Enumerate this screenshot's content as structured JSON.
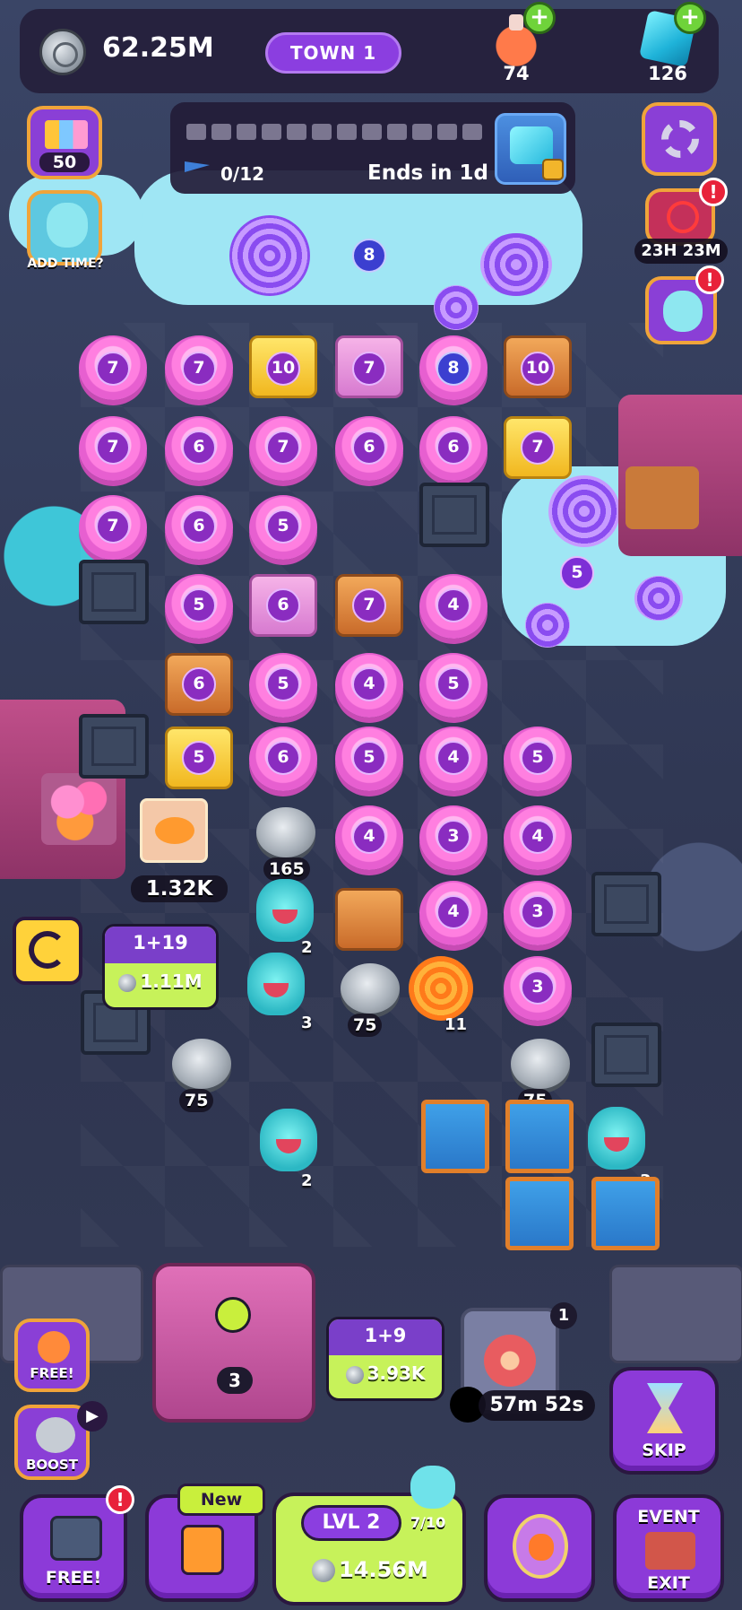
{
  "header": {
    "coins": "62.25M",
    "town_label": "TOWN 1",
    "potions": "74",
    "gems": "126"
  },
  "event_progress": {
    "progress": "0/12",
    "ends_in": "Ends in 1d",
    "segments_total": 12,
    "segments_filled": 0
  },
  "left_side": {
    "collection_count": "50",
    "add_time_label": "ADD TIME?"
  },
  "right_side": {
    "timer": "23H 23M"
  },
  "cloud_badges": {
    "top": "8",
    "right": "5"
  },
  "board": {
    "row1": [
      "7",
      "7",
      "10",
      "7",
      "8",
      "10"
    ],
    "row2": [
      "7",
      "6",
      "7",
      "6",
      "6",
      "7"
    ],
    "row3": [
      "7",
      "6",
      "5"
    ],
    "row4": [
      "5",
      "6",
      "7",
      "4"
    ],
    "row5": [
      "6",
      "5",
      "4",
      "5"
    ],
    "row6": [
      "5",
      "6",
      "5",
      "4",
      "5"
    ],
    "row7": [
      "4",
      "3",
      "4"
    ],
    "row8": [
      "4",
      "3"
    ],
    "row9": [
      "3"
    ],
    "silver_counts": [
      "165",
      "75",
      "75",
      "75"
    ],
    "monster_levels": [
      "2",
      "3",
      "2",
      "3"
    ],
    "swirl_count": "11",
    "candy_shop_price": "1.32K"
  },
  "refresh_card": {
    "label": "1+19",
    "price": "1.11M"
  },
  "generator": {
    "level": "3",
    "card_label": "1+9",
    "card_price": "3.93K"
  },
  "oven": {
    "badge": "1",
    "timer": "57m 52s"
  },
  "buttons": {
    "free_spin": "FREE!",
    "boost": "BOOST",
    "skip": "SKIP",
    "free_chest": "FREE!",
    "new_tag": "New",
    "level": "LVL 2",
    "level_progress": "7/10",
    "level_price": "14.56M",
    "event_exit_top": "EVENT",
    "event_exit_bottom": "EXIT"
  },
  "colors": {
    "accent_purple": "#8b3ee0",
    "lime": "#c7f25a",
    "candy_pink": "#ff7fe0",
    "alert_red": "#e8223a"
  }
}
